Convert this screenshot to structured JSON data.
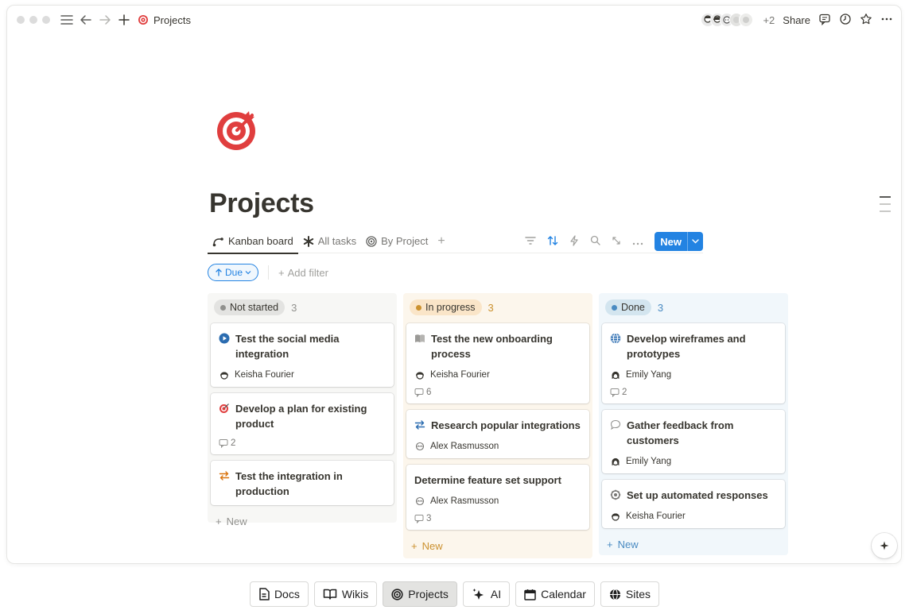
{
  "topbar": {
    "breadcrumb": "Projects",
    "extra_count": "+2",
    "share_label": "Share"
  },
  "page": {
    "title": "Projects"
  },
  "views": {
    "tabs": [
      {
        "label": "Kanban board",
        "icon": "kanban-icon",
        "active": true
      },
      {
        "label": "All tasks",
        "icon": "asterisk-icon",
        "active": false
      },
      {
        "label": "By Project",
        "icon": "target-icon",
        "active": false
      }
    ],
    "new_label": "New"
  },
  "filters": {
    "sort_chip": "Due",
    "add_filter": "Add filter"
  },
  "colors": {
    "accent": "#2383e2",
    "not_started_bg": "#f7f7f5",
    "in_progress_bg": "#fcf6ec",
    "done_bg": "#f1f7fb",
    "brand_red": "#e03e3e"
  },
  "board": {
    "columns": [
      {
        "name": "Not started",
        "count": "3",
        "new_label": "New",
        "cards": [
          {
            "title": "Test the social media integration",
            "icon": "play-circle-icon",
            "assignee": "Keisha Fourier",
            "comments": ""
          },
          {
            "title": "Develop a plan for existing product",
            "icon": "target-icon",
            "assignee": "",
            "comments": "2"
          },
          {
            "title": "Test the integration in production",
            "icon": "arrows-swap-icon",
            "assignee": "",
            "comments": ""
          }
        ]
      },
      {
        "name": "In progress",
        "count": "3",
        "new_label": "New",
        "cards": [
          {
            "title": "Test the new onboarding process",
            "icon": "book-icon",
            "assignee": "Keisha Fourier",
            "comments": "6"
          },
          {
            "title": "Research popular integrations",
            "icon": "arrows-swap-icon",
            "assignee": "Alex Rasmusson",
            "comments": ""
          },
          {
            "title": "Determine feature set support",
            "icon": "",
            "assignee": "Alex Rasmusson",
            "comments": "3"
          }
        ]
      },
      {
        "name": "Done",
        "count": "3",
        "new_label": "New",
        "cards": [
          {
            "title": "Develop wireframes and prototypes",
            "icon": "globe-icon",
            "assignee": "Emily Yang",
            "comments": "2"
          },
          {
            "title": "Gather feedback from customers",
            "icon": "speech-bubble-icon",
            "assignee": "Emily Yang",
            "comments": ""
          },
          {
            "title": "Set up automated responses",
            "icon": "gear-icon",
            "assignee": "Keisha Fourier",
            "comments": ""
          }
        ]
      }
    ]
  },
  "dock": {
    "items": [
      {
        "label": "Docs",
        "icon": "doc-icon"
      },
      {
        "label": "Wikis",
        "icon": "book-open-icon"
      },
      {
        "label": "Projects",
        "icon": "target-icon",
        "active": true
      },
      {
        "label": "AI",
        "icon": "sparkle-icon"
      },
      {
        "label": "Calendar",
        "icon": "calendar-icon"
      },
      {
        "label": "Sites",
        "icon": "globe-icon"
      }
    ]
  }
}
